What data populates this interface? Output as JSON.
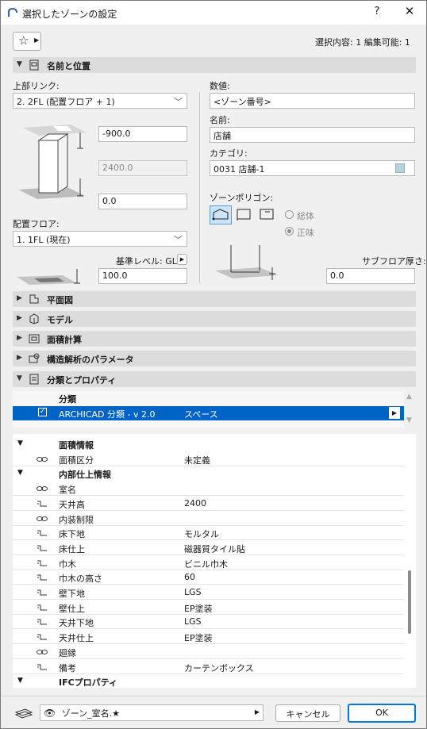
{
  "title": "選択したゾーンの設定",
  "help_label": "?",
  "close_label": "✕",
  "selection_info": "選択内容: 1 編集可能: 1",
  "sections": {
    "name_position": "名前と位置",
    "floor_plan": "平面図",
    "model": "モデル",
    "area_calc": "面積計算",
    "structural": "構造解析のパラメータ",
    "classification": "分類とプロパティ"
  },
  "left": {
    "top_link_label": "上部リンク:",
    "top_link_value": "2. 2FL (配置フロア + 1)",
    "top_offset": "-900.0",
    "height": "2400.0",
    "bottom_offset": "0.0",
    "home_floor_label": "配置フロア:",
    "home_floor_value": "1. 1FL (現在)",
    "ref_level_label": "基準レベル: GL",
    "ref_level_value": "100.0"
  },
  "right": {
    "number_label": "数値:",
    "number_value": "<ゾーン番号>",
    "name_label": "名前:",
    "name_value": "店舗",
    "category_label": "カテゴリ:",
    "category_value": "0031  店舗-1",
    "category_color": "#b7d3dc",
    "polygon_label": "ゾーンポリゴン:",
    "radio_gross": "総体",
    "radio_net": "正味",
    "subfloor_label": "サブフロア厚さ:",
    "subfloor_value": "0.0"
  },
  "classification": {
    "header": "分類",
    "system": "ARCHICAD 分類 - v 2.0",
    "value": "スペース"
  },
  "properties": {
    "group1": "面積情報",
    "g1_rows": [
      {
        "name": "面積区分",
        "value": "未定義"
      }
    ],
    "group2": "内部仕上情報",
    "g2_rows": [
      {
        "name": "室名",
        "value": ""
      },
      {
        "name": "天井高",
        "value": "2400"
      },
      {
        "name": "内装制限",
        "value": ""
      },
      {
        "name": "床下地",
        "value": "モルタル"
      },
      {
        "name": "床仕上",
        "value": "磁器質タイル貼"
      },
      {
        "name": "巾木",
        "value": "ビニル巾木"
      },
      {
        "name": "巾木の高さ",
        "value": "60"
      },
      {
        "name": "壁下地",
        "value": "LGS"
      },
      {
        "name": "壁仕上",
        "value": "EP塗装"
      },
      {
        "name": "天井下地",
        "value": "LGS"
      },
      {
        "name": "天井仕上",
        "value": "EP塗装"
      },
      {
        "name": "廻縁",
        "value": ""
      },
      {
        "name": "備考",
        "value": "カーテンボックス"
      }
    ],
    "group3": "IFCプロパティ"
  },
  "footer": {
    "layer_value": "ゾーン_室名.★",
    "cancel_label": "キャンセル",
    "ok_label": "OK"
  },
  "colors": {
    "accent": "#0078d7",
    "select_bg": "#0063c6"
  }
}
